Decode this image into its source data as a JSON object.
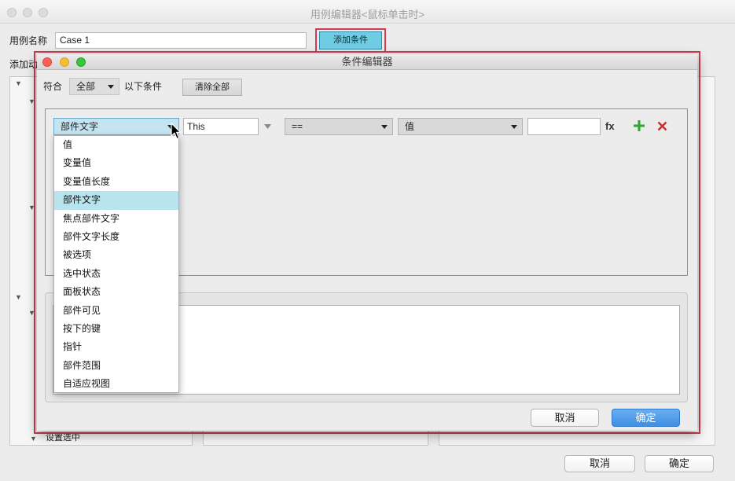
{
  "case_editor": {
    "title": "用例编辑器<鼠标单击时>",
    "case_name_label": "用例名称",
    "case_name_value": "Case 1",
    "add_condition_label": "添加条件",
    "add_actions_label": "添加动",
    "action_item_label": "设置选中",
    "cancel_label": "取消",
    "ok_label": "确定"
  },
  "condition_editor": {
    "title": "条件编辑器",
    "match_label": "符合",
    "match_value": "全部",
    "match_suffix": "以下条件",
    "clear_all_label": "清除全部",
    "condition": {
      "type_value": "部件文字",
      "target_value": "This",
      "operator_value": "==",
      "value_type": "值",
      "value_input": "",
      "fx_label": "fx"
    },
    "dropdown_options": [
      "值",
      "变量值",
      "变量值长度",
      "部件文字",
      "焦点部件文字",
      "部件文字长度",
      "被选项",
      "选中状态",
      "面板状态",
      "部件可见",
      "按下的键",
      "指针",
      "部件范围",
      "自适应视图"
    ],
    "highlighted_option_index": 3,
    "description_text": "",
    "cancel_label": "取消",
    "ok_label": "确定"
  },
  "icons": {
    "window_controls": [
      "close-window-icon",
      "minimize-window-icon",
      "zoom-window-icon"
    ],
    "select_arrow": "chevron-down-icon",
    "tree_toggle": "disclosure-triangle-icon",
    "add_condition_row": "add-icon",
    "remove_condition_row": "delete-icon",
    "pointer": "mouse-cursor-icon"
  },
  "colors": {
    "highlight_frame": "#d13a4f",
    "add_condition_button": "#6fcde3",
    "dropdown_highlight": "#b8e4ee",
    "add_icon": "#2fa82f",
    "delete_icon": "#d52b2b",
    "primary_button": "#3f8fe4",
    "traffic_red": "#fd5f57",
    "traffic_yellow": "#f4bf2e",
    "traffic_green": "#3dc243"
  }
}
